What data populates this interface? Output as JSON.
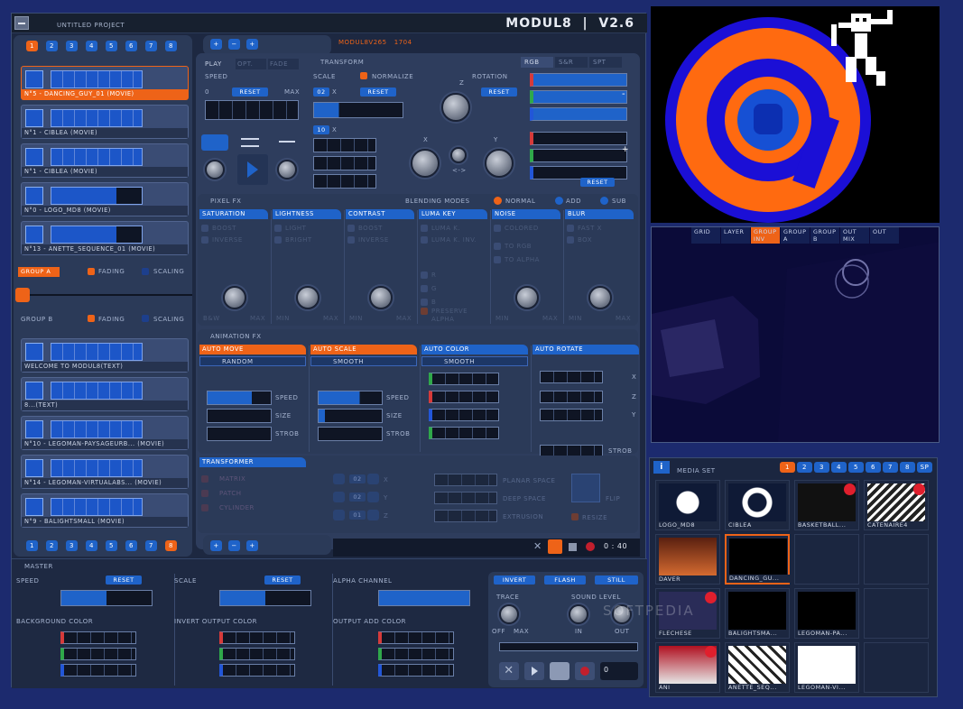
{
  "app": {
    "project_title": "UNTITLED PROJECT",
    "logo": "MODUL8",
    "version": "V2.6",
    "sub_label": "MODUL8V265",
    "sub_number": "1704"
  },
  "banks_top": [
    "1",
    "2",
    "3",
    "4",
    "5",
    "6",
    "7",
    "8"
  ],
  "banks_bottom": [
    "1",
    "2",
    "3",
    "4",
    "5",
    "6",
    "7",
    "8"
  ],
  "group_a": {
    "clips": [
      "N°5 - DANCING_GUY_01 (MOVIE)",
      "N°1 - CIBLEA (MOVIE)",
      "N°1 - CIBLEA (MOVIE)",
      "N°0 - LOGO_MD8 (MOVIE)",
      "N°13 - ANETTE_SEQUENCE_01 (MOVIE)"
    ],
    "label": "GROUP A",
    "fading": "FADING",
    "scaling": "SCALING"
  },
  "group_b": {
    "clips": [
      "WELCOME TO MODUL8(TEXT)",
      "8...(TEXT)",
      "N°10 - LEGOMAN-PAYSAGEURB... (MOVIE)",
      "N°14 - LEGOMAN-VIRTUALABS... (MOVIE)",
      "N°9 - BALIGHTSMALL (MOVIE)"
    ],
    "label": "GROUP B",
    "fading": "FADING",
    "scaling": "SCALING"
  },
  "mix": {
    "a_b_level": 0.0
  },
  "play": {
    "tabs": [
      "PLAY",
      "OPT.",
      "FADE"
    ],
    "speed": "SPEED",
    "min": "0",
    "reset": "RESET",
    "max": "MAX"
  },
  "transform": {
    "title": "TRANSFORM",
    "scale": "SCALE",
    "normalize": "NORMALIZE",
    "rotation": "ROTATION",
    "reset": "RESET",
    "z": "Z",
    "x": "X",
    "y": "Y",
    "xy_badge": "02",
    "xy_axis": "X",
    "badge2": "10",
    "badge2_axis": "X",
    "arrows": "<->"
  },
  "rgb": {
    "tabs": [
      "RGB",
      "S&R",
      "SPT"
    ],
    "minus": "-",
    "plus": "+",
    "reset": "RESET"
  },
  "pixel_fx": {
    "title": "PIXEL FX",
    "blending": "BLENDING MODES",
    "normal": "NORMAL",
    "add": "ADD",
    "sub": "SUB",
    "columns": [
      {
        "head": "SATURATION",
        "opts": [
          "BOOST",
          "INVERSE"
        ],
        "lo": "B&W",
        "hi": "MAX"
      },
      {
        "head": "LIGHTNESS",
        "opts": [
          "LIGHT",
          "BRIGHT"
        ],
        "lo": "MIN",
        "hi": "MAX"
      },
      {
        "head": "CONTRAST",
        "opts": [
          "BOOST",
          "INVERSE"
        ],
        "lo": "MIN",
        "hi": "MAX"
      },
      {
        "head": "LUMA KEY",
        "opts": [
          "LUMA K.",
          "LUMA K. INV.",
          "R",
          "G",
          "B",
          "PRESERVE",
          "ALPHA"
        ],
        "lo": "",
        "hi": ""
      },
      {
        "head": "NOISE",
        "opts": [
          "COLORED",
          "TO RGB",
          "TO ALPHA"
        ],
        "lo": "MIN",
        "hi": "MAX"
      },
      {
        "head": "BLUR",
        "opts": [
          "FAST X",
          "BOX"
        ],
        "lo": "MIN",
        "hi": "MAX"
      }
    ]
  },
  "animation_fx": {
    "title": "ANIMATION FX",
    "columns": [
      {
        "head": "AUTO MOVE",
        "mode": "RANDOM",
        "speed": "SPEED",
        "size": "SIZE",
        "strob": "STROB",
        "speed_level": 0.7,
        "size_level": 0.0
      },
      {
        "head": "AUTO SCALE",
        "mode": "SMOOTH",
        "speed": "SPEED",
        "size": "SIZE",
        "strob": "STROB",
        "speed_level": 0.65,
        "size_level": 0.1
      },
      {
        "head": "AUTO COLOR",
        "mode": "SMOOTH"
      },
      {
        "head": "AUTO ROTATE",
        "x": "X",
        "z": "Z",
        "y": "Y",
        "strob": "STROB"
      }
    ]
  },
  "transformer": {
    "title": "TRANSFORMER",
    "items": [
      "MATRIX",
      "PATCH",
      "CYLINDER"
    ],
    "badges": [
      "02",
      "02",
      "01"
    ],
    "axes": [
      "X",
      "Y",
      "Z"
    ],
    "planar": "PLANAR SPACE",
    "deep": "DEEP SPACE",
    "extrusion": "EXTRUSION",
    "flip": "FLIP",
    "resize": "RESIZE"
  },
  "transport": {
    "time": "0 : 40"
  },
  "master": {
    "title": "MASTER",
    "speed": "SPEED",
    "scale": "SCALE",
    "alpha": "ALPHA CHANNEL",
    "reset": "RESET",
    "bg": "BACKGROUND COLOR",
    "invert_out": "INVERT OUTPUT COLOR",
    "add_out": "OUTPUT ADD COLOR",
    "invert": "INVERT",
    "flash": "FLASH",
    "still": "STILL",
    "trace": "TRACE",
    "off": "OFF",
    "max": "MAX",
    "sound": "SOUND LEVEL",
    "in": "IN",
    "out": "OUT",
    "rec_count": "0"
  },
  "preview_tabs": [
    "GRID",
    "LAYER",
    "GROUP INV",
    "GROUP A",
    "GROUP B",
    "OUT MIX",
    "OUT"
  ],
  "media_set": {
    "title": "MEDIA SET",
    "info": "i",
    "banks": [
      "1",
      "2",
      "3",
      "4",
      "5",
      "6",
      "7",
      "8",
      "SP"
    ],
    "items": [
      "LOGO_MD8",
      "CIBLEA",
      "BASKETBALL...",
      "CATENAIRE4",
      "DAVER",
      "DANCING_GU...",
      "",
      "",
      "FLECHESE",
      "BALIGHTSMA...",
      "LEGOMAN-PA...",
      "",
      "ANI",
      "ANETTE_SEQ...",
      "LEGOMAN-VI...",
      ""
    ]
  },
  "watermark": "SOFTPEDIA",
  "colors": {
    "accent": "#ee6318",
    "blue": "#1f63c9",
    "panel": "#2b3a58"
  }
}
